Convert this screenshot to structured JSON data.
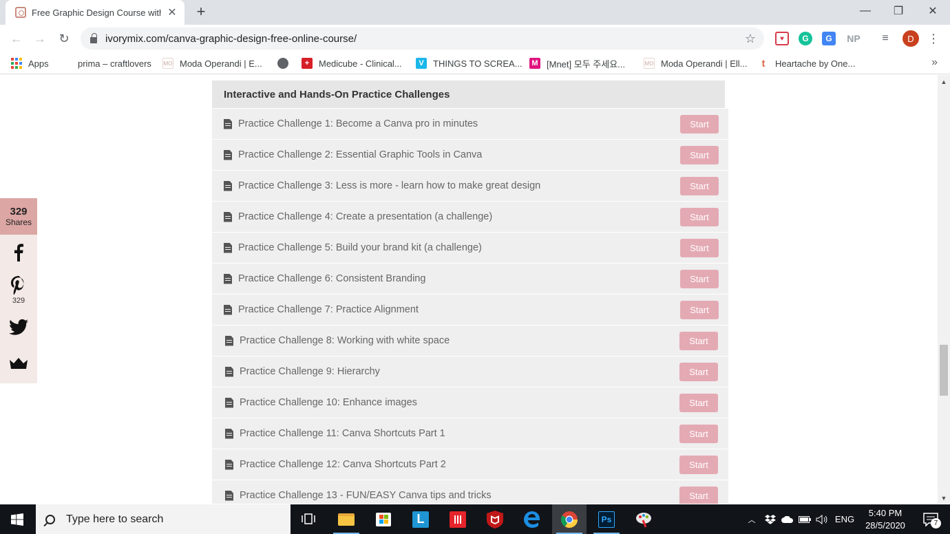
{
  "browser": {
    "tab": {
      "title": "Free Graphic Design Course with Canva",
      "close": "✕"
    },
    "new_tab": "+",
    "window": {
      "minimize": "—",
      "restore": "❐",
      "close": "✕"
    },
    "nav": {
      "back": "←",
      "forward": "→",
      "reload": "↻"
    },
    "url": "ivorymix.com/canva-graphic-design-free-online-course/",
    "bookmark_star": "☆",
    "extensions": {
      "np": "NP",
      "translate": "G",
      "grammarly": "G",
      "pocket": "♥",
      "reading_list": "≡"
    },
    "profile_initial": "D",
    "menu": "⋮"
  },
  "bookmarks": {
    "items": [
      {
        "label": "Apps"
      },
      {
        "label": "prima – craftlovers"
      },
      {
        "label": "Moda Operandi | E...",
        "icon_text": "MO"
      },
      {
        "label": "Medicube - Clinical...",
        "icon_text": "+"
      },
      {
        "label": "THINGS TO SCREA...",
        "icon_text": "V"
      },
      {
        "label": "[Mnet] 모두 주세요...",
        "icon_text": "M"
      },
      {
        "label": "Moda Operandi | Ell...",
        "icon_text": "MO"
      },
      {
        "label": "Heartache by One...",
        "icon_text": "t"
      }
    ],
    "more": "»"
  },
  "share": {
    "total": "329",
    "total_label": "Shares",
    "pinterest_count": "329"
  },
  "course": {
    "section_title": "Interactive and Hands-On Practice Challenges",
    "start_label": "Start",
    "lessons": [
      "Practice Challenge 1: Become a Canva pro in minutes",
      "Practice Challenge 2: Essential Graphic Tools in Canva",
      "Practice Challenge 3: Less is more - learn how to make great design",
      "Practice Challenge 4: Create a presentation (a challenge)",
      "Practice Challenge 5: Build your brand kit (a challenge)",
      "Practice Challenge 6: Consistent Branding",
      "Practice Challenge 7: Practice Alignment",
      "Practice Challenge 8: Working with white space",
      "Practice Challenge 9: Hierarchy",
      "Practice Challenge 10: Enhance images",
      "Practice Challenge 11: Canva Shortcuts Part 1",
      "Practice Challenge 12: Canva Shortcuts Part 2",
      "Practice Challenge 13 - FUN/EASY Canva tips and tricks"
    ]
  },
  "scrollbar": {
    "up": "▲",
    "down": "▼"
  },
  "taskbar": {
    "search_placeholder": "Type here to search",
    "language": "ENG",
    "time": "5:40 PM",
    "date": "28/5/2020",
    "notification_count": "7",
    "apps": {
      "l_app": "L",
      "ps": "Ps"
    }
  },
  "colors": {
    "start_button": "#e4aab4",
    "share_count_bg": "#dba6a3",
    "lesson_bg": "#efefef",
    "section_bg": "#e6e6e6"
  }
}
